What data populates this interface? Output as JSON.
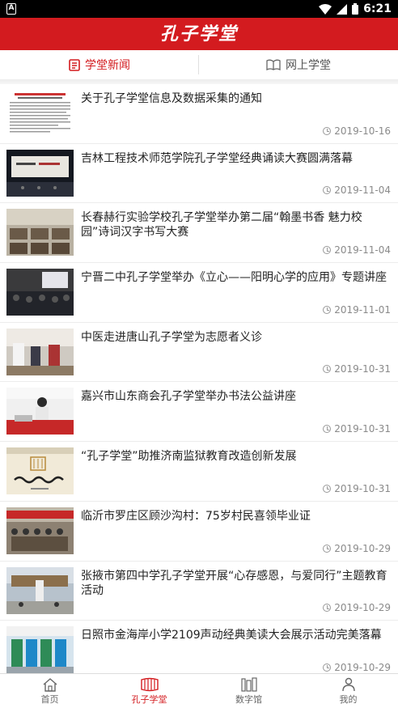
{
  "status": {
    "time": "6:21",
    "icons": [
      "notification-icon",
      "wifi-icon",
      "signal-icon",
      "battery-icon"
    ]
  },
  "header": {
    "title": "孔子学堂"
  },
  "tabs": [
    {
      "label": "学堂新闻",
      "icon": "news-icon",
      "active": true
    },
    {
      "label": "网上学堂",
      "icon": "book-icon",
      "active": false
    }
  ],
  "news": [
    {
      "title": "关于孔子学堂信息及数据采集的通知",
      "date": "2019-10-16"
    },
    {
      "title": "吉林工程技术师范学院孔子学堂经典诵读大赛圆满落幕",
      "date": "2019-11-04"
    },
    {
      "title": "长春赫行实验学校孔子学堂举办第二届“翰墨书香 魅力校园”诗词汉字书写大赛",
      "date": "2019-11-04"
    },
    {
      "title": "宁晋二中孔子学堂举办《立心——阳明心学的应用》专题讲座",
      "date": "2019-11-01"
    },
    {
      "title": "中医走进唐山孔子学堂为志愿者义诊",
      "date": "2019-10-31"
    },
    {
      "title": "嘉兴市山东商会孔子学堂举办书法公益讲座",
      "date": "2019-10-31"
    },
    {
      "title": "“孔子学堂”助推济南监狱教育改造创新发展",
      "date": "2019-10-31"
    },
    {
      "title": "临沂市罗庄区顾沙沟村：75岁村民喜领毕业证",
      "date": "2019-10-29"
    },
    {
      "title": "张掖市第四中学孔子学堂开展“心存感恩，与爱同行”主题教育活动",
      "date": "2019-10-29"
    },
    {
      "title": "日照市金海岸小学2109声动经典美读大会展示活动完美落幕",
      "date": "2019-10-29"
    }
  ],
  "bottom_nav": [
    {
      "label": "首页",
      "icon": "home-icon",
      "active": false
    },
    {
      "label": "孔子学堂",
      "icon": "bamboo-scroll-icon",
      "active": true
    },
    {
      "label": "数字馆",
      "icon": "library-icon",
      "active": false
    },
    {
      "label": "我的",
      "icon": "person-icon",
      "active": false
    }
  ],
  "colors": {
    "brand": "#d31b1f",
    "date_text": "#8a8a8a"
  }
}
